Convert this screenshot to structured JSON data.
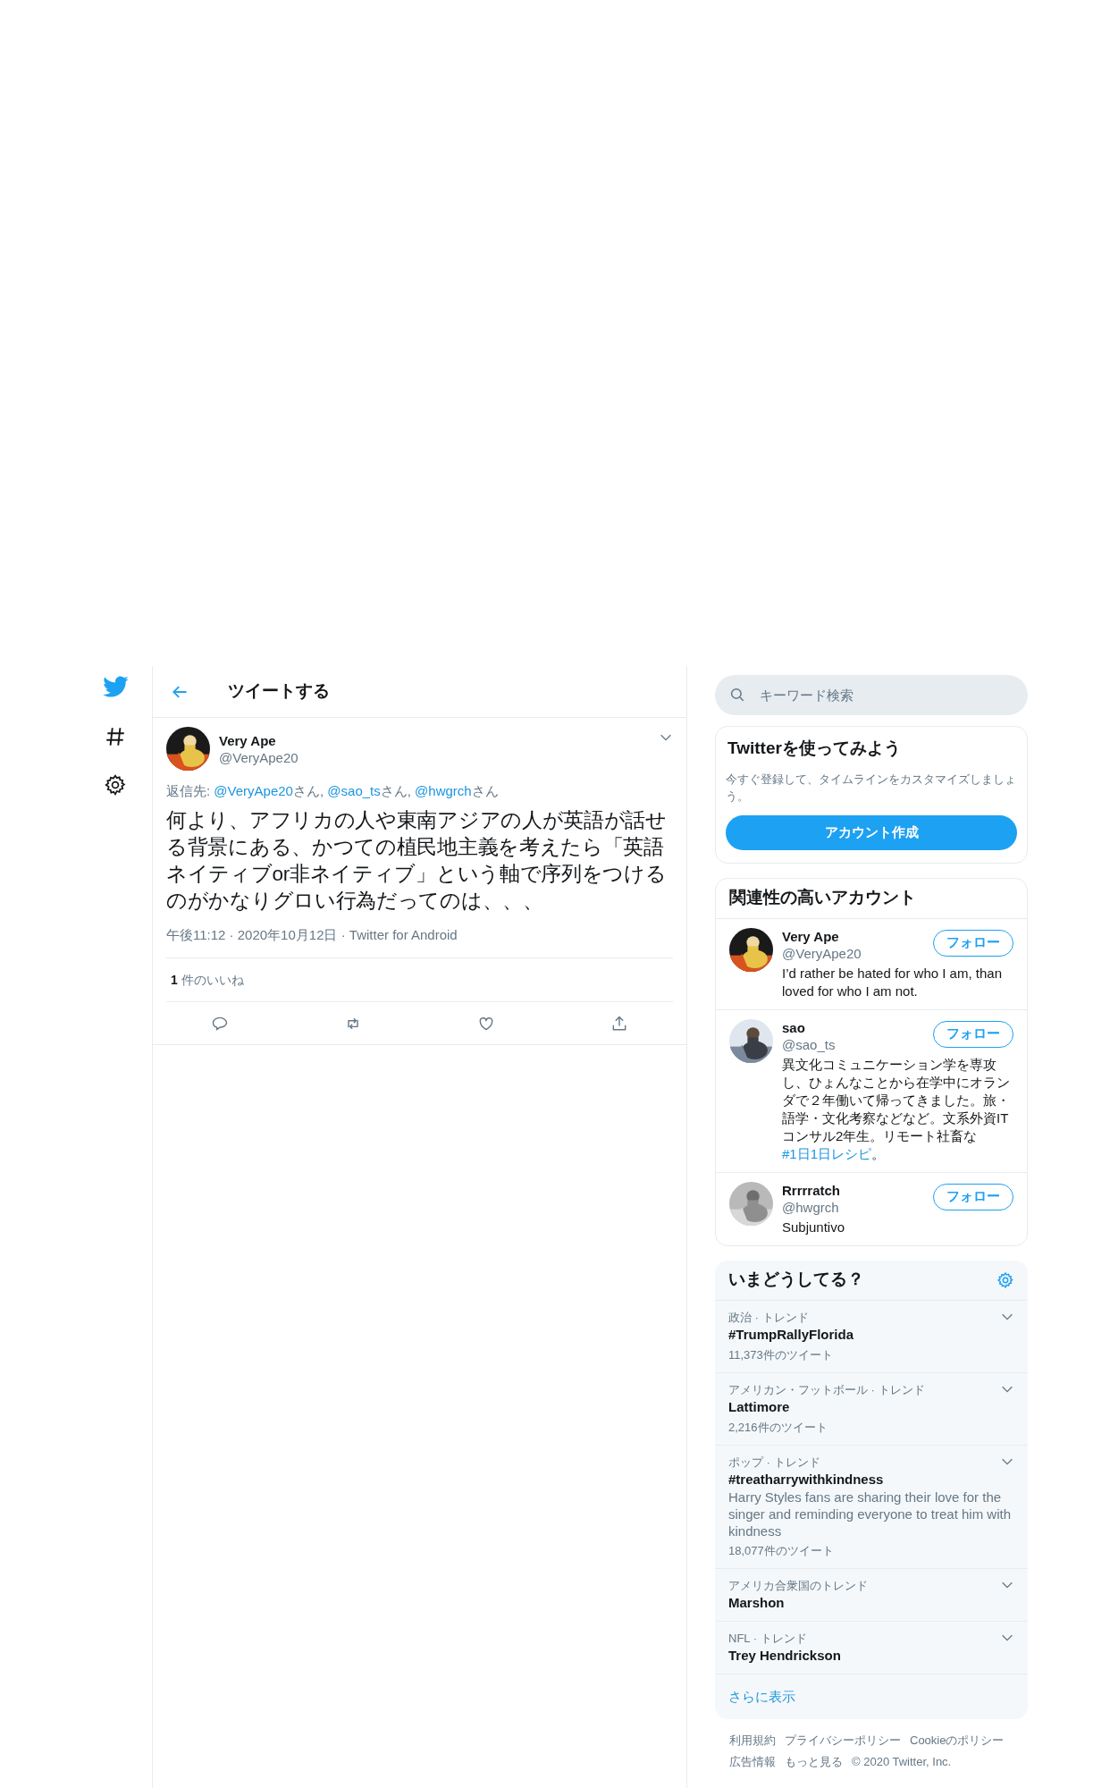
{
  "header": {
    "title": "ツイートする"
  },
  "tweet": {
    "name": "Very Ape",
    "handle": "@VeryApe20",
    "reply": [
      {
        "kind": "text",
        "text": "返信先: "
      },
      {
        "kind": "link",
        "text": "@VeryApe20"
      },
      {
        "kind": "text",
        "text": "さん, "
      },
      {
        "kind": "link",
        "text": "@sao_ts"
      },
      {
        "kind": "text",
        "text": "さん, "
      },
      {
        "kind": "link",
        "text": "@hwgrch"
      },
      {
        "kind": "text",
        "text": "さん"
      }
    ],
    "text": "何より、アフリカの人や東南アジアの人が英語が話せる背景にある、かつての植民地主義を考えたら「英語ネイティブor非ネイティブ」という軸で序列をつけるのがかなりグロい行為だってのは、、、",
    "meta": "午後11:12 · 2020年10月12日 · Twitter for Android",
    "likes": {
      "count": "1",
      "label": "件のいいね"
    }
  },
  "search": {
    "placeholder": "キーワード検索"
  },
  "signup": {
    "title": "Twitterを使ってみよう",
    "text": "今すぐ登録して、タイムラインをカスタマイズしましょう。",
    "button": "アカウント作成"
  },
  "accounts": {
    "title": "関連性の高いアカウント",
    "items": [
      {
        "name": "Very Ape",
        "handle": "@VeryApe20",
        "button": "フォロー",
        "bio": [
          {
            "kind": "text",
            "text": "I’d rather be hated for who I am, than loved for who I am not."
          }
        ]
      },
      {
        "name": "sao",
        "handle": "@sao_ts",
        "button": "フォロー",
        "bio": [
          {
            "kind": "text",
            "text": "異文化コミュニケーション学を専攻し、ひょんなことから在学中にオランダで２年働いて帰ってきました。旅・語学・文化考察などなど。文系外資ITコンサル2年生。リモート社畜な "
          },
          {
            "kind": "link",
            "text": "#1日1日レシピ"
          },
          {
            "kind": "text",
            "text": "。"
          }
        ]
      },
      {
        "name": "Rrrrratch",
        "handle": "@hwgrch",
        "button": "フォロー",
        "bio": [
          {
            "kind": "text",
            "text": "Subjuntivo"
          }
        ]
      }
    ]
  },
  "trends": {
    "title": "いまどうしてる？",
    "items": [
      {
        "context": "政治 · トレンド",
        "title": "#TrumpRallyFlorida",
        "count": "11,373件のツイート"
      },
      {
        "context": "アメリカン・フットボール · トレンド",
        "title": "Lattimore",
        "count": "2,216件のツイート"
      },
      {
        "context": "ポップ · トレンド",
        "title": "#treatharrywithkindness",
        "description": "Harry Styles fans are sharing their love for the singer and reminding everyone to treat him with kindness",
        "count": "18,077件のツイート"
      },
      {
        "context": "アメリカ合衆国のトレンド",
        "title": "Marshon"
      },
      {
        "context": "NFL · トレンド",
        "title": "Trey Hendrickson"
      }
    ],
    "more": "さらに表示"
  },
  "footer": {
    "links": [
      "利用規約",
      "プライバシーポリシー",
      "Cookieのポリシー",
      "広告情報",
      "もっと見る"
    ],
    "copyright": "© 2020 Twitter, Inc."
  }
}
